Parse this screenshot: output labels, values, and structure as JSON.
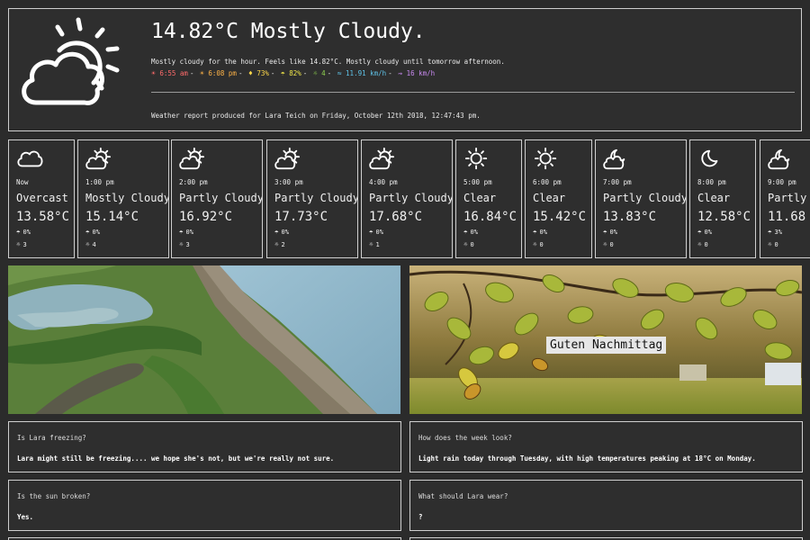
{
  "header": {
    "headline": "14.82°C Mostly Cloudy.",
    "summary": "Mostly cloudy for the hour. Feels like 14.82°C. Mostly cloudy until tomorrow afternoon.",
    "stats": {
      "sunrise": "6:55 am",
      "sunset": "6:08 pm",
      "humidity": "73%",
      "precip": "82%",
      "uv": "4",
      "wind": "11.91 km/h",
      "gust": "16 km/h",
      "colors": {
        "sunrise": "#ff6b6b",
        "sunset": "#ffb347",
        "humidity": "#ffd84a",
        "precip": "#f0e64a",
        "uv": "#8fd14f",
        "wind": "#5fc3e8",
        "gust": "#c88af0"
      }
    },
    "report": "Weather report produced for Lara Teich on Friday, October 12th 2018, 12:47:43 pm."
  },
  "hourly": [
    {
      "time": "Now",
      "condition": "Overcast",
      "temp": "13.58°C",
      "pop": "0%",
      "uv": "3",
      "icon": "cloud-icon"
    },
    {
      "time": "1:00 pm",
      "condition": "Mostly Cloudy",
      "temp": "15.14°C",
      "pop": "0%",
      "uv": "4",
      "icon": "partly-cloudy-icon"
    },
    {
      "time": "2:00 pm",
      "condition": "Partly Cloudy",
      "temp": "16.92°C",
      "pop": "0%",
      "uv": "3",
      "icon": "partly-cloudy-icon"
    },
    {
      "time": "3:00 pm",
      "condition": "Partly Cloudy",
      "temp": "17.73°C",
      "pop": "0%",
      "uv": "2",
      "icon": "partly-cloudy-icon"
    },
    {
      "time": "4:00 pm",
      "condition": "Partly Cloudy",
      "temp": "17.68°C",
      "pop": "0%",
      "uv": "1",
      "icon": "partly-cloudy-icon"
    },
    {
      "time": "5:00 pm",
      "condition": "Clear",
      "temp": "16.84°C",
      "pop": "0%",
      "uv": "0",
      "icon": "sun-icon"
    },
    {
      "time": "6:00 pm",
      "condition": "Clear",
      "temp": "15.42°C",
      "pop": "0%",
      "uv": "0",
      "icon": "sun-icon"
    },
    {
      "time": "7:00 pm",
      "condition": "Partly Cloudy",
      "temp": "13.83°C",
      "pop": "0%",
      "uv": "0",
      "icon": "night-cloudy-icon"
    },
    {
      "time": "8:00 pm",
      "condition": "Clear",
      "temp": "12.58°C",
      "pop": "0%",
      "uv": "0",
      "icon": "moon-icon"
    },
    {
      "time": "9:00 pm",
      "condition": "Partly",
      "temp": "11.68",
      "pop": "3%",
      "uv": "0",
      "icon": "night-cloudy-icon"
    }
  ],
  "photos": {
    "greeting": "Guten Nachmittag"
  },
  "qa": [
    {
      "question": "Is Lara freezing?",
      "answer": "Lara might still be freezing.... we hope she's not, but we're really not sure."
    },
    {
      "question": "How does the week look?",
      "answer": "Light rain today through Tuesday, with high temperatures peaking at 18°C on Monday."
    },
    {
      "question": "Is the sun broken?",
      "answer": "Yes."
    },
    {
      "question": "What should Lara wear?",
      "answer": "?"
    }
  ]
}
